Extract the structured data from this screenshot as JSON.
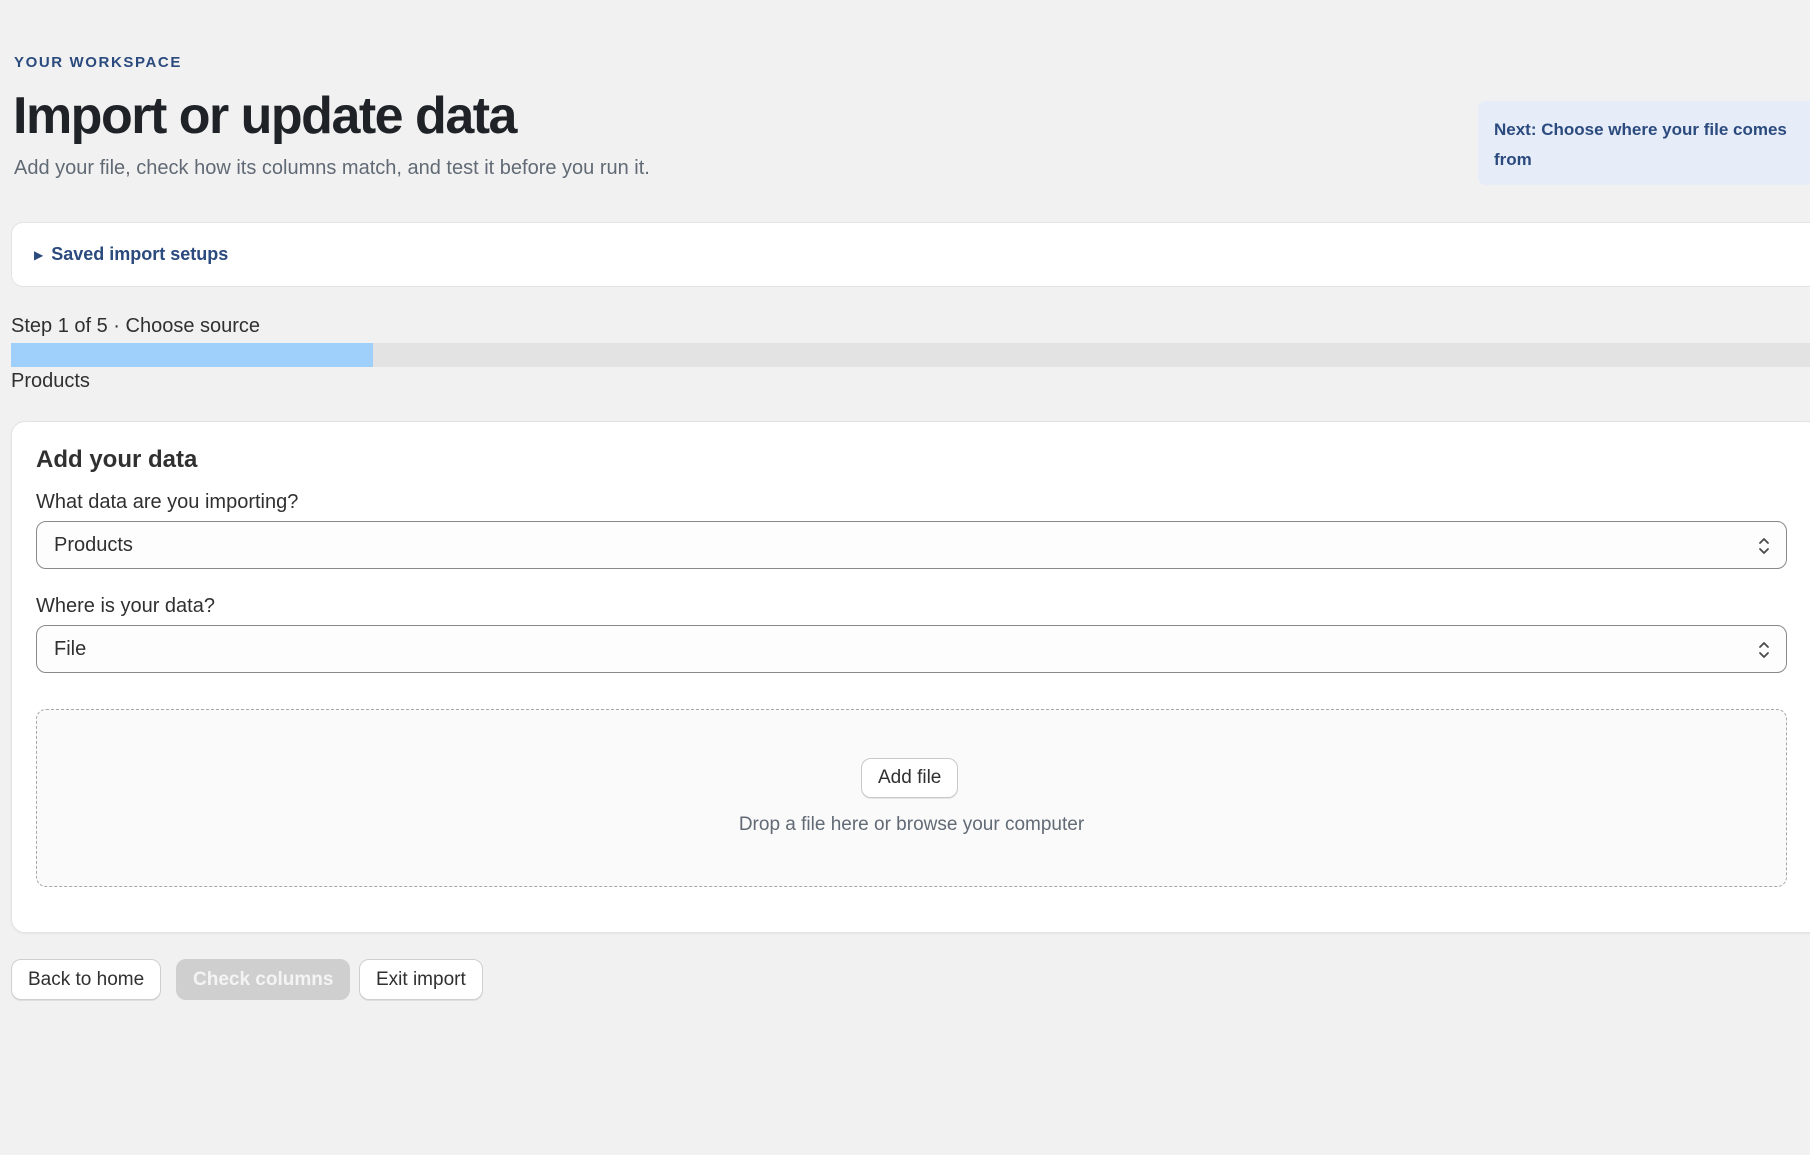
{
  "header": {
    "eyebrow": "YOUR WORKSPACE",
    "title": "Import or update data",
    "subtitle": "Add your file, check how its columns match, and test it before you run it.",
    "next_hint": "Next: Choose where your file comes from"
  },
  "saved_setups": {
    "label": "Saved import setups",
    "expanded": false
  },
  "progress": {
    "step_text": "Step 1 of 5 · Choose source",
    "fraction": 0.2,
    "caption": "Products",
    "fill_color": "#9fd0fb"
  },
  "card": {
    "title": "Add your data",
    "data_type": {
      "label": "What data are you importing?",
      "value": "Products"
    },
    "source": {
      "label": "Where is your data?",
      "value": "File"
    },
    "dropzone": {
      "button_label": "Add file",
      "hint": "Drop a file here or browse your computer"
    }
  },
  "footer": {
    "back_label": "Back to home",
    "check_label": "Check columns",
    "check_disabled": true,
    "exit_label": "Exit import"
  },
  "colors": {
    "accent": "#2b4a7e",
    "background": "#f1f1f1",
    "hint_background": "#e6edf8"
  }
}
